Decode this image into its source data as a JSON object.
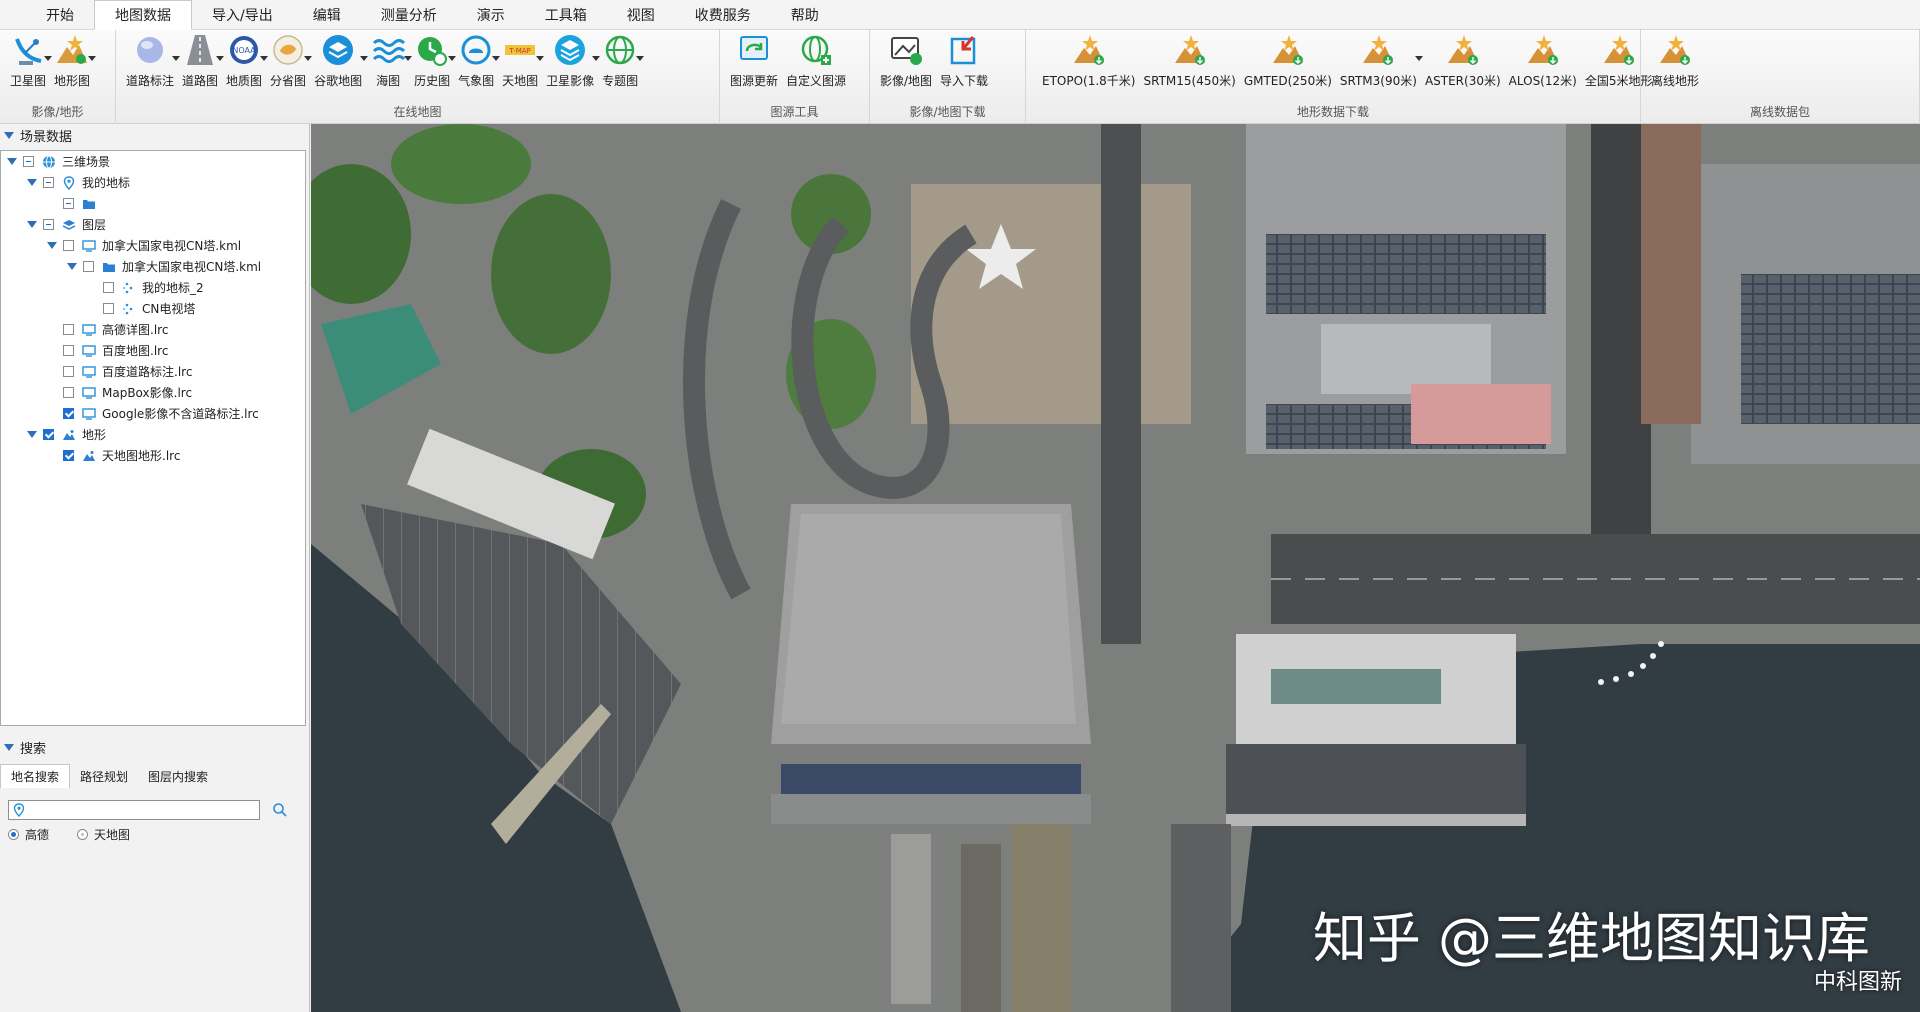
{
  "menu": {
    "tabs": [
      "开始",
      "地图数据",
      "导入/导出",
      "编辑",
      "测量分析",
      "演示",
      "工具箱",
      "视图",
      "收费服务",
      "帮助"
    ],
    "active_index": 1
  },
  "ribbon": {
    "groups": [
      {
        "label": "影像/地形",
        "items": [
          {
            "label": "卫星图",
            "icon": "satellite-dish-icon",
            "dropdown": true
          },
          {
            "label": "地形图",
            "icon": "terrain-star-icon",
            "dropdown": true
          }
        ]
      },
      {
        "label": "在线地图",
        "items": [
          {
            "label": "道路标注",
            "icon": "road-label-globe-icon",
            "dropdown": true
          },
          {
            "label": "道路图",
            "icon": "road-icon",
            "dropdown": true
          },
          {
            "label": "地质图",
            "icon": "noaa-icon",
            "dropdown": true
          },
          {
            "label": "分省图",
            "icon": "province-map-icon",
            "dropdown": true
          },
          {
            "label": "谷歌地图",
            "icon": "layers-icon",
            "dropdown": true
          },
          {
            "label": "海图",
            "icon": "waves-icon",
            "dropdown": true
          },
          {
            "label": "历史图",
            "icon": "history-icon",
            "dropdown": true
          },
          {
            "label": "气象图",
            "icon": "weather-icon",
            "dropdown": true
          },
          {
            "label": "天地图",
            "icon": "tianditu-icon",
            "dropdown": true
          },
          {
            "label": "卫星影像",
            "icon": "satellite-layers-icon",
            "dropdown": true
          },
          {
            "label": "专题图",
            "icon": "globe-icon",
            "dropdown": true
          }
        ]
      },
      {
        "label": "图源工具",
        "items": [
          {
            "label": "图源更新",
            "icon": "source-update-icon",
            "dropdown": false
          },
          {
            "label": "自定义图源",
            "icon": "custom-source-icon",
            "dropdown": false
          }
        ]
      },
      {
        "label": "影像/地图下载",
        "items": [
          {
            "label": "影像/地图",
            "icon": "image-download-icon",
            "dropdown": false
          },
          {
            "label": "导入下载",
            "icon": "import-download-icon",
            "dropdown": false
          }
        ]
      },
      {
        "label": "地形数据下载",
        "items": [
          {
            "label": "ETOPO(1.8千米)",
            "icon": "terrain-download-icon",
            "dropdown": false
          },
          {
            "label": "SRTM15(450米)",
            "icon": "terrain-download-icon",
            "dropdown": false
          },
          {
            "label": "GMTED(250米)",
            "icon": "terrain-download-icon",
            "dropdown": false
          },
          {
            "label": "SRTM3(90米)",
            "icon": "terrain-download-icon",
            "dropdown": true
          },
          {
            "label": "ASTER(30米)",
            "icon": "terrain-download-icon",
            "dropdown": false
          },
          {
            "label": "ALOS(12米)",
            "icon": "terrain-download-icon",
            "dropdown": false
          },
          {
            "label": "全国5米地形",
            "icon": "terrain-download-icon",
            "dropdown": false
          }
        ]
      },
      {
        "label": "离线数据包",
        "items": [
          {
            "label": "离线地形",
            "icon": "terrain-download-icon",
            "dropdown": false
          }
        ]
      }
    ]
  },
  "scene_panel": {
    "title": "场景数据",
    "tree": [
      {
        "label": "三维场景",
        "level": 0,
        "expander": "open",
        "check": "partial",
        "icon": "globe-icon"
      },
      {
        "label": "我的地标",
        "level": 1,
        "expander": "open",
        "check": "partial",
        "icon": "placemark-icon"
      },
      {
        "label": "",
        "level": 2,
        "expander": "none",
        "check": "partial",
        "icon": "folder-icon"
      },
      {
        "label": "图层",
        "level": 1,
        "expander": "open",
        "check": "partial",
        "icon": "layers-icon"
      },
      {
        "label": "加拿大国家电视CN塔.kml",
        "level": 2,
        "expander": "open",
        "check": "unchecked",
        "icon": "monitor-icon"
      },
      {
        "label": "加拿大国家电视CN塔.kml",
        "level": 3,
        "expander": "open",
        "check": "unchecked",
        "icon": "folder-icon"
      },
      {
        "label": "我的地标_2",
        "level": 4,
        "expander": "none",
        "check": "unchecked",
        "icon": "dots-icon"
      },
      {
        "label": "CN电视塔",
        "level": 4,
        "expander": "none",
        "check": "unchecked",
        "icon": "dots-icon"
      },
      {
        "label": "高德详图.lrc",
        "level": 2,
        "expander": "none",
        "check": "unchecked",
        "icon": "monitor-icon"
      },
      {
        "label": "百度地图.lrc",
        "level": 2,
        "expander": "none",
        "check": "unchecked",
        "icon": "monitor-icon"
      },
      {
        "label": "百度道路标注.lrc",
        "level": 2,
        "expander": "none",
        "check": "unchecked",
        "icon": "monitor-icon"
      },
      {
        "label": "MapBox影像.lrc",
        "level": 2,
        "expander": "none",
        "check": "unchecked",
        "icon": "monitor-icon"
      },
      {
        "label": "Google影像不含道路标注.lrc",
        "level": 2,
        "expander": "none",
        "check": "checked",
        "icon": "monitor-icon"
      },
      {
        "label": "地形",
        "level": 1,
        "expander": "open",
        "check": "checked",
        "icon": "terrain-icon"
      },
      {
        "label": "天地图地形.lrc",
        "level": 2,
        "expander": "none",
        "check": "checked",
        "icon": "terrain-icon"
      }
    ]
  },
  "search_panel": {
    "title": "搜索",
    "tabs": [
      "地名搜索",
      "路径规划",
      "图层内搜索"
    ],
    "active_tab": 0,
    "input_value": "",
    "placeholder": "",
    "providers": [
      {
        "label": "高德",
        "selected": true
      },
      {
        "label": "天地图",
        "selected": false
      }
    ]
  },
  "map": {
    "watermark": "知乎 @三维地图知识库",
    "watermark_sub": "中科图新"
  },
  "colors": {
    "accent": "#1f6fd1",
    "tree_blue": "#2c6fb6",
    "water": "#2f3b42",
    "ribbon_orange": "#e8962a",
    "ribbon_blue": "#1b8fd8",
    "ribbon_green": "#2aa84a"
  }
}
